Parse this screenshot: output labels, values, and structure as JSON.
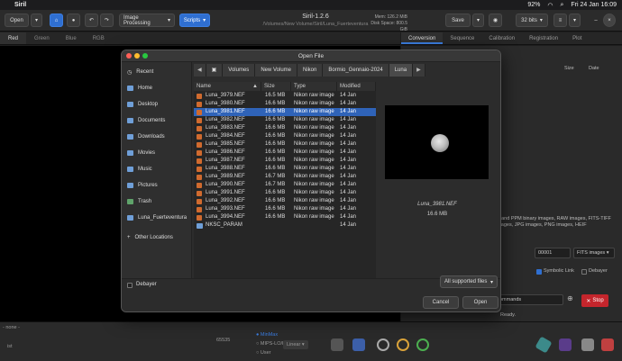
{
  "menubar": {
    "app": "Siril",
    "battery": "92%",
    "datetime": "Fri 24 Jan  16:09"
  },
  "header": {
    "open_label": "Open",
    "image_processing_label": "Image Processing",
    "scripts_label": "Scripts",
    "title": "Siril-1.2.6",
    "path": "/Volumes/New Volume/Siril/Luna_Fuerteventura",
    "mem_label": "Mem: 126.2 MiB",
    "disk_label": "Disk Space: 800.5 GiB",
    "save_label": "Save",
    "bits_label": "32 bits"
  },
  "channel_tabs": [
    "Red",
    "Green",
    "Blue",
    "RGB"
  ],
  "right_tabs": [
    "Conversion",
    "Sequence",
    "Calibration",
    "Registration",
    "Plot"
  ],
  "right_panel": {
    "col_size": "Size",
    "col_date": "Date",
    "support_text": "M and PPM binary images, RAW images, FITS-TIFF images, JPG images, PNG images, HEIF",
    "index_value": "00001",
    "format_value": "FITS images",
    "symbolic_link_label": "Symbolic Link",
    "debayer_label": "Debayer",
    "commands_placeholder": "ommands",
    "stop_label": "Stop",
    "status": "Ready."
  },
  "bottombar": {
    "none_label": "- none -",
    "minmax_label": "MinMax",
    "mips_label": "MIPS-LO/HI",
    "user_label": "User",
    "linear_label": "Linear",
    "value_65535": "65535",
    "list_label": "ist"
  },
  "dialog": {
    "title": "Open File",
    "places": [
      {
        "label": "Recent",
        "icon": "clock-icon"
      },
      {
        "label": "Home",
        "icon": "home-folder-icon"
      },
      {
        "label": "Desktop",
        "icon": "desktop-folder-icon"
      },
      {
        "label": "Documents",
        "icon": "documents-folder-icon"
      },
      {
        "label": "Downloads",
        "icon": "downloads-folder-icon"
      },
      {
        "label": "Movies",
        "icon": "movies-folder-icon"
      },
      {
        "label": "Music",
        "icon": "music-folder-icon"
      },
      {
        "label": "Pictures",
        "icon": "pictures-folder-icon"
      },
      {
        "label": "Trash",
        "icon": "trash-icon"
      },
      {
        "label": "Luna_Fuerteventura",
        "icon": "folder-icon"
      },
      {
        "label": "Other Locations",
        "icon": "plus-icon"
      }
    ],
    "path": [
      "Volumes",
      "New Volume",
      "Nikon",
      "Bormio_Gennaio-2024",
      "Luna"
    ],
    "columns": {
      "name": "Name",
      "size": "Size",
      "type": "Type",
      "modified": "Modified"
    },
    "files": [
      {
        "name": "Luna_3979.NEF",
        "size": "16.5 MB",
        "type": "Nikon raw image",
        "modified": "14 Jan"
      },
      {
        "name": "Luna_3980.NEF",
        "size": "16.6 MB",
        "type": "Nikon raw image",
        "modified": "14 Jan"
      },
      {
        "name": "Luna_3981.NEF",
        "size": "16.6 MB",
        "type": "Nikon raw image",
        "modified": "14 Jan"
      },
      {
        "name": "Luna_3982.NEF",
        "size": "16.6 MB",
        "type": "Nikon raw image",
        "modified": "14 Jan"
      },
      {
        "name": "Luna_3983.NEF",
        "size": "16.6 MB",
        "type": "Nikon raw image",
        "modified": "14 Jan"
      },
      {
        "name": "Luna_3984.NEF",
        "size": "16.6 MB",
        "type": "Nikon raw image",
        "modified": "14 Jan"
      },
      {
        "name": "Luna_3985.NEF",
        "size": "16.6 MB",
        "type": "Nikon raw image",
        "modified": "14 Jan"
      },
      {
        "name": "Luna_3986.NEF",
        "size": "16.6 MB",
        "type": "Nikon raw image",
        "modified": "14 Jan"
      },
      {
        "name": "Luna_3987.NEF",
        "size": "16.6 MB",
        "type": "Nikon raw image",
        "modified": "14 Jan"
      },
      {
        "name": "Luna_3988.NEF",
        "size": "16.6 MB",
        "type": "Nikon raw image",
        "modified": "14 Jan"
      },
      {
        "name": "Luna_3989.NEF",
        "size": "16.7 MB",
        "type": "Nikon raw image",
        "modified": "14 Jan"
      },
      {
        "name": "Luna_3990.NEF",
        "size": "16.7 MB",
        "type": "Nikon raw image",
        "modified": "14 Jan"
      },
      {
        "name": "Luna_3991.NEF",
        "size": "16.6 MB",
        "type": "Nikon raw image",
        "modified": "14 Jan"
      },
      {
        "name": "Luna_3992.NEF",
        "size": "16.6 MB",
        "type": "Nikon raw image",
        "modified": "14 Jan"
      },
      {
        "name": "Luna_3993.NEF",
        "size": "16.6 MB",
        "type": "Nikon raw image",
        "modified": "14 Jan"
      },
      {
        "name": "Luna_3994.NEF",
        "size": "16.6 MB",
        "type": "Nikon raw image",
        "modified": "14 Jan"
      },
      {
        "name": "NKSC_PARAM",
        "size": "",
        "type": "",
        "modified": "14 Jan"
      }
    ],
    "selected_index": 2,
    "preview": {
      "name": "Luna_3981.NEF",
      "size": "16.6 MB"
    },
    "debayer_label": "Debayer",
    "filter_label": "All supported files",
    "cancel_label": "Cancel",
    "open_label": "Open"
  },
  "colors": {
    "accent": "#2f6fd1",
    "selection": "#2f63b8",
    "stop": "#c4252c"
  }
}
